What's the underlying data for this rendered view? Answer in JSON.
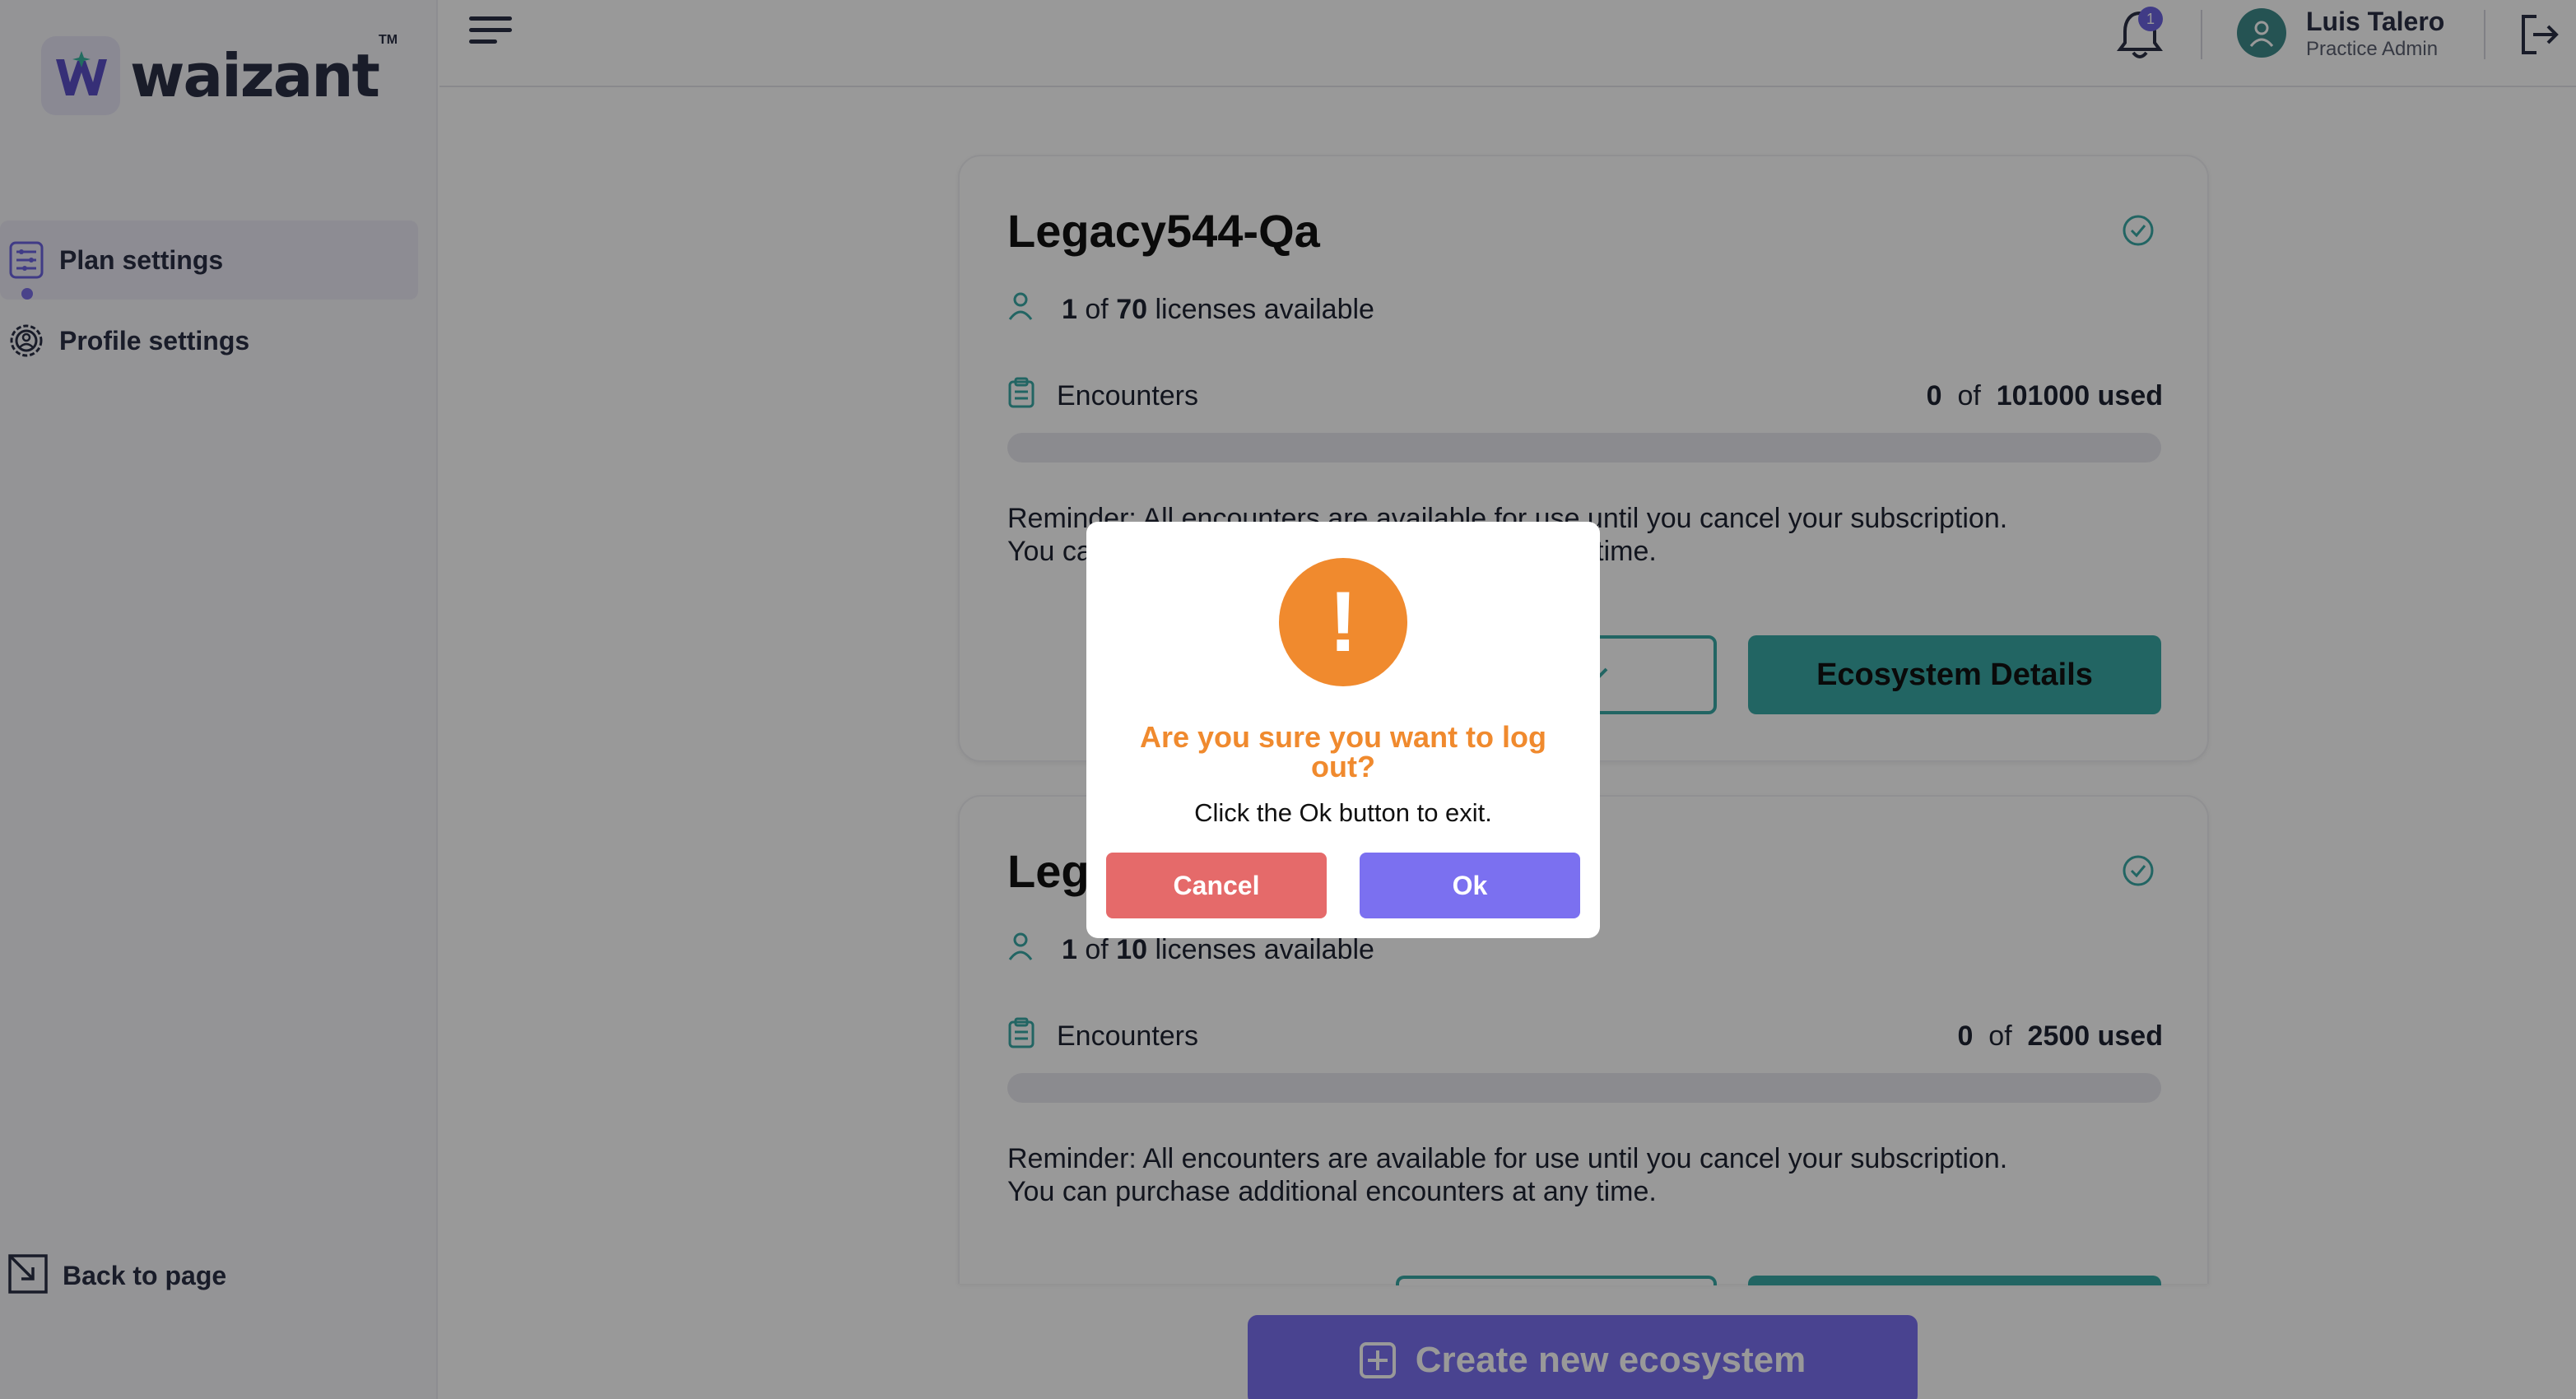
{
  "logo": {
    "text": "waizant",
    "tm": "TM"
  },
  "sidebar": {
    "items": [
      {
        "label": "Plan settings",
        "icon": "plan-settings-icon",
        "active": true
      },
      {
        "label": "Profile settings",
        "icon": "gear-icon",
        "active": false
      }
    ],
    "back_label": "Back to page"
  },
  "header": {
    "notification_count": "1",
    "user_name": "Luis Talero",
    "user_role": "Practice Admin"
  },
  "cards": [
    {
      "title": "Legacy544-Qa",
      "licenses_used": "1",
      "licenses_of": "of",
      "licenses_total": "70",
      "licenses_suffix": "licenses available",
      "encounters_label": "Encounters",
      "encounters_used": "0",
      "encounters_of": "of",
      "encounters_total": "101000 used",
      "encounters_fraction": 0,
      "reminder_line1": "Reminder: All encounters are available for use until you cancel your subscription.",
      "reminder_line2": "You can purchase additional encounters at any time.",
      "plan_button_partial": "n",
      "details_button": "Ecosystem Details"
    },
    {
      "title": "Leg",
      "licenses_used": "1",
      "licenses_of": "of",
      "licenses_total": "10",
      "licenses_suffix": "licenses available",
      "encounters_label": "Encounters",
      "encounters_used": "0",
      "encounters_of": "of",
      "encounters_total": "2500 used",
      "encounters_fraction": 0,
      "reminder_line1": "Reminder: All encounters are available for use until you cancel your subscription.",
      "reminder_line2": "You can purchase additional encounters at any time."
    }
  ],
  "create_button": "Create new ecosystem",
  "modal": {
    "icon": "!",
    "title_line1": "Are you sure you want to log",
    "title_line2": "out?",
    "text": "Click the Ok button to exit.",
    "cancel_label": "Cancel",
    "ok_label": "Ok"
  },
  "colors": {
    "accent_teal": "#3aa8a6",
    "accent_purple": "#7b70f0",
    "warning_orange": "#f08a2e",
    "cancel_red": "#e56a6a"
  }
}
